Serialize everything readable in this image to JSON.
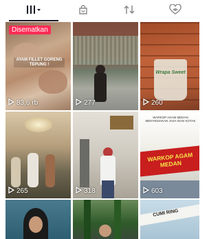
{
  "tabs": [
    {
      "name": "videos",
      "icon": "grid-icon",
      "active": true
    },
    {
      "name": "shop",
      "icon": "shopping-bag-icon",
      "active": false
    },
    {
      "name": "reposts",
      "icon": "repost-icon",
      "active": false
    },
    {
      "name": "liked",
      "icon": "heart-eye-icon",
      "active": false
    }
  ],
  "videos": [
    {
      "views": "83,6 rb",
      "badge": "Disematkan",
      "caption": "AYAM FILLET GORENG TEPUNG !"
    },
    {
      "views": "277"
    },
    {
      "views": "260",
      "caption": "Wrapa Sweet"
    },
    {
      "views": "265"
    },
    {
      "views": "318"
    },
    {
      "views": "603",
      "caption_small": "WARKOP AGAM MEDAN MENYEDIAKAN JASA NASI KOTAK",
      "caption": "WARKOP AGAM MEDAN"
    },
    {
      "views": ""
    },
    {
      "views": ""
    },
    {
      "views": "",
      "caption": "CUMI RING"
    }
  ],
  "colors": {
    "accent": "#fe2c55",
    "active_tab": "#161823",
    "inactive_tab": "#8a8a8a"
  }
}
